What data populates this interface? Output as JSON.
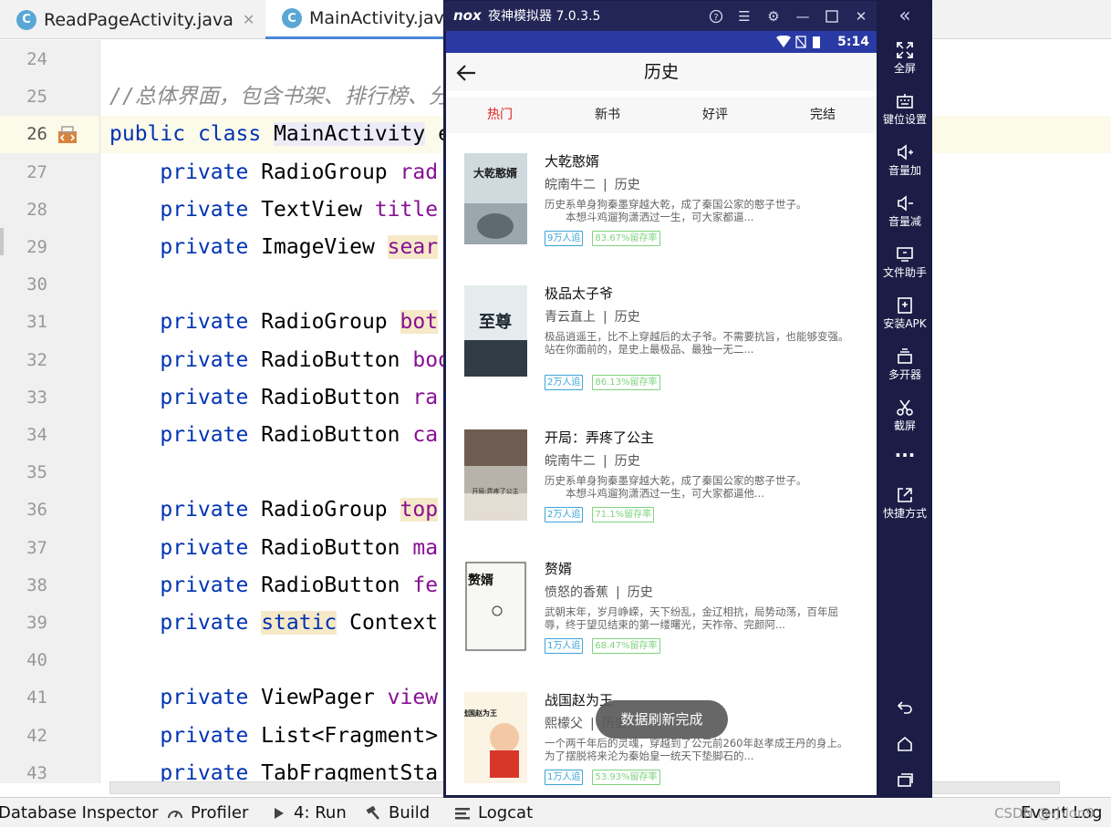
{
  "ide": {
    "tabs": [
      {
        "label": "ReadPageActivity.java",
        "active": false,
        "icon": "java-class-icon"
      },
      {
        "label": "MainActivity.java",
        "active": true,
        "icon": "java-class-icon"
      }
    ],
    "editor": {
      "current_line": "26",
      "lines": [
        {
          "n": "24",
          "tokens": []
        },
        {
          "n": "25",
          "tokens": [
            {
              "t": "//总体界面，包含书架、排行榜、分类",
              "c": "cmt"
            }
          ]
        },
        {
          "n": "26",
          "tokens": [
            {
              "t": "public",
              "c": "kw"
            },
            {
              "t": " "
            },
            {
              "t": "class",
              "c": "kw"
            },
            {
              "t": " "
            },
            {
              "t": "MainActivity",
              "c": "hl2"
            },
            {
              "t": " e"
            }
          ]
        },
        {
          "n": "27",
          "tokens": [
            {
              "t": "    "
            },
            {
              "t": "private",
              "c": "kw"
            },
            {
              "t": " RadioGroup "
            },
            {
              "t": "rad",
              "c": "fld"
            }
          ]
        },
        {
          "n": "28",
          "tokens": [
            {
              "t": "    "
            },
            {
              "t": "private",
              "c": "kw"
            },
            {
              "t": " TextView "
            },
            {
              "t": "title",
              "c": "fld"
            }
          ]
        },
        {
          "n": "29",
          "tokens": [
            {
              "t": "    "
            },
            {
              "t": "private",
              "c": "kw"
            },
            {
              "t": " ImageView "
            },
            {
              "t": "sear",
              "c": "fld hl"
            }
          ]
        },
        {
          "n": "30",
          "tokens": []
        },
        {
          "n": "31",
          "tokens": [
            {
              "t": "    "
            },
            {
              "t": "private",
              "c": "kw"
            },
            {
              "t": " RadioGroup "
            },
            {
              "t": "bot",
              "c": "fld hl"
            }
          ]
        },
        {
          "n": "32",
          "tokens": [
            {
              "t": "    "
            },
            {
              "t": "private",
              "c": "kw"
            },
            {
              "t": " RadioButton "
            },
            {
              "t": "boo",
              "c": "fld"
            }
          ]
        },
        {
          "n": "33",
          "tokens": [
            {
              "t": "    "
            },
            {
              "t": "private",
              "c": "kw"
            },
            {
              "t": " RadioButton "
            },
            {
              "t": "ra",
              "c": "fld"
            }
          ]
        },
        {
          "n": "34",
          "tokens": [
            {
              "t": "    "
            },
            {
              "t": "private",
              "c": "kw"
            },
            {
              "t": " RadioButton "
            },
            {
              "t": "ca",
              "c": "fld"
            }
          ]
        },
        {
          "n": "35",
          "tokens": []
        },
        {
          "n": "36",
          "tokens": [
            {
              "t": "    "
            },
            {
              "t": "private",
              "c": "kw"
            },
            {
              "t": " RadioGroup "
            },
            {
              "t": "top",
              "c": "fld hl"
            }
          ]
        },
        {
          "n": "37",
          "tokens": [
            {
              "t": "    "
            },
            {
              "t": "private",
              "c": "kw"
            },
            {
              "t": " RadioButton "
            },
            {
              "t": "ma",
              "c": "fld"
            }
          ]
        },
        {
          "n": "38",
          "tokens": [
            {
              "t": "    "
            },
            {
              "t": "private",
              "c": "kw"
            },
            {
              "t": " RadioButton "
            },
            {
              "t": "fe",
              "c": "fld"
            }
          ]
        },
        {
          "n": "39",
          "tokens": [
            {
              "t": "    "
            },
            {
              "t": "private",
              "c": "kw"
            },
            {
              "t": " "
            },
            {
              "t": "static",
              "c": "kw hl"
            },
            {
              "t": " Context"
            }
          ]
        },
        {
          "n": "40",
          "tokens": []
        },
        {
          "n": "41",
          "tokens": [
            {
              "t": "    "
            },
            {
              "t": "private",
              "c": "kw"
            },
            {
              "t": " ViewPager "
            },
            {
              "t": "view",
              "c": "fld"
            }
          ]
        },
        {
          "n": "42",
          "tokens": [
            {
              "t": "    "
            },
            {
              "t": "private",
              "c": "kw"
            },
            {
              "t": " List<Fragment>"
            }
          ]
        },
        {
          "n": "43",
          "tokens": [
            {
              "t": "    "
            },
            {
              "t": "private",
              "c": "kw"
            },
            {
              "t": " TabFragmentSta"
            }
          ]
        }
      ]
    },
    "bottom_tools": [
      {
        "label": "Database Inspector",
        "icon": "database-icon"
      },
      {
        "label": "Profiler",
        "icon": "gauge-icon"
      },
      {
        "label": "4: Run",
        "icon": "play-icon"
      },
      {
        "label": "Build",
        "icon": "hammer-icon"
      },
      {
        "label": "Logcat",
        "icon": "list-icon"
      },
      {
        "label": "Event Log",
        "icon": "event-log-icon"
      }
    ],
    "watermark": "CSDN @小lon9"
  },
  "emulator": {
    "title": "夜神模拟器 7.0.3.5",
    "logo_text": "nox",
    "accent": "#2a3aa4",
    "side_buttons": [
      {
        "label": "全屏",
        "icon": "fullscreen-icon"
      },
      {
        "label": "键位设置",
        "icon": "keyboard-icon"
      },
      {
        "label": "音量加",
        "icon": "volume-up-icon"
      },
      {
        "label": "音量减",
        "icon": "volume-down-icon"
      },
      {
        "label": "文件助手",
        "icon": "file-helper-icon"
      },
      {
        "label": "安装APK",
        "icon": "apk-icon"
      },
      {
        "label": "多开器",
        "icon": "multi-instance-icon"
      },
      {
        "label": "截屏",
        "icon": "scissors-icon"
      },
      {
        "label": "",
        "icon": "more-icon"
      },
      {
        "label": "快捷方式",
        "icon": "shortcut-icon"
      }
    ],
    "nav_buttons": [
      "back-icon",
      "home-icon",
      "recents-icon"
    ]
  },
  "app": {
    "status_time": "5:14",
    "page_title": "历史",
    "tabs": [
      {
        "label": "热门",
        "active": true
      },
      {
        "label": "新书",
        "active": false
      },
      {
        "label": "好评",
        "active": false
      },
      {
        "label": "完结",
        "active": false
      }
    ],
    "books": [
      {
        "title": "大乾憨婿",
        "author": "皖南牛二",
        "category": "历史",
        "desc1": "历史系单身狗秦墨穿越大乾，成了秦国公家的憨子世子。",
        "desc2": "　　本想斗鸡遛狗潇洒过一生，可大家都逼...",
        "followers": "9万人追",
        "retention": "83.67%留存率",
        "cover_text": "大乾憨婿"
      },
      {
        "title": "极品太子爷",
        "author": "青云直上",
        "category": "历史",
        "desc1": "极品逍遥王，比不上穿越后的太子爷。不需要抗旨，也能够变强。",
        "desc2": "站在你面前的，是史上最极品、最独一无二...",
        "followers": "2万人追",
        "retention": "86.13%留存率",
        "cover_text": "至尊"
      },
      {
        "title": "开局：弄疼了公主",
        "author": "皖南牛二",
        "category": "历史",
        "desc1": "历史系单身狗秦墨穿越大乾，成了秦国公家的憨子世子。",
        "desc2": "　　本想斗鸡遛狗潇洒过一生，可大家都逼他...",
        "followers": "2万人追",
        "retention": "71.1%留存率",
        "cover_text": "开局:弄疼了公主"
      },
      {
        "title": "赘婿",
        "author": "愤怒的香蕉",
        "category": "历史",
        "desc1": "武朝末年，岁月峥嵘，天下纷乱，金辽相抗，局势动荡，百年屈辱，终于望见结束的第一缕曙光，天祚帝、完颜阿...",
        "desc2": "",
        "followers": "1万人追",
        "retention": "68.47%留存率",
        "cover_text": "赘婿"
      },
      {
        "title": "战国赵为王",
        "author": "熙檬父",
        "category": "历史",
        "desc1": "一个两千年后的灵魂，穿越到了公元前260年赵孝成王丹的身上。为了摆脱将来沦为秦始皇一统天下垫脚石的...",
        "desc2": "",
        "followers": "1万人追",
        "retention": "53.93%留存率",
        "cover_text": "战国赵为王"
      }
    ],
    "toast": "数据刷新完成"
  }
}
